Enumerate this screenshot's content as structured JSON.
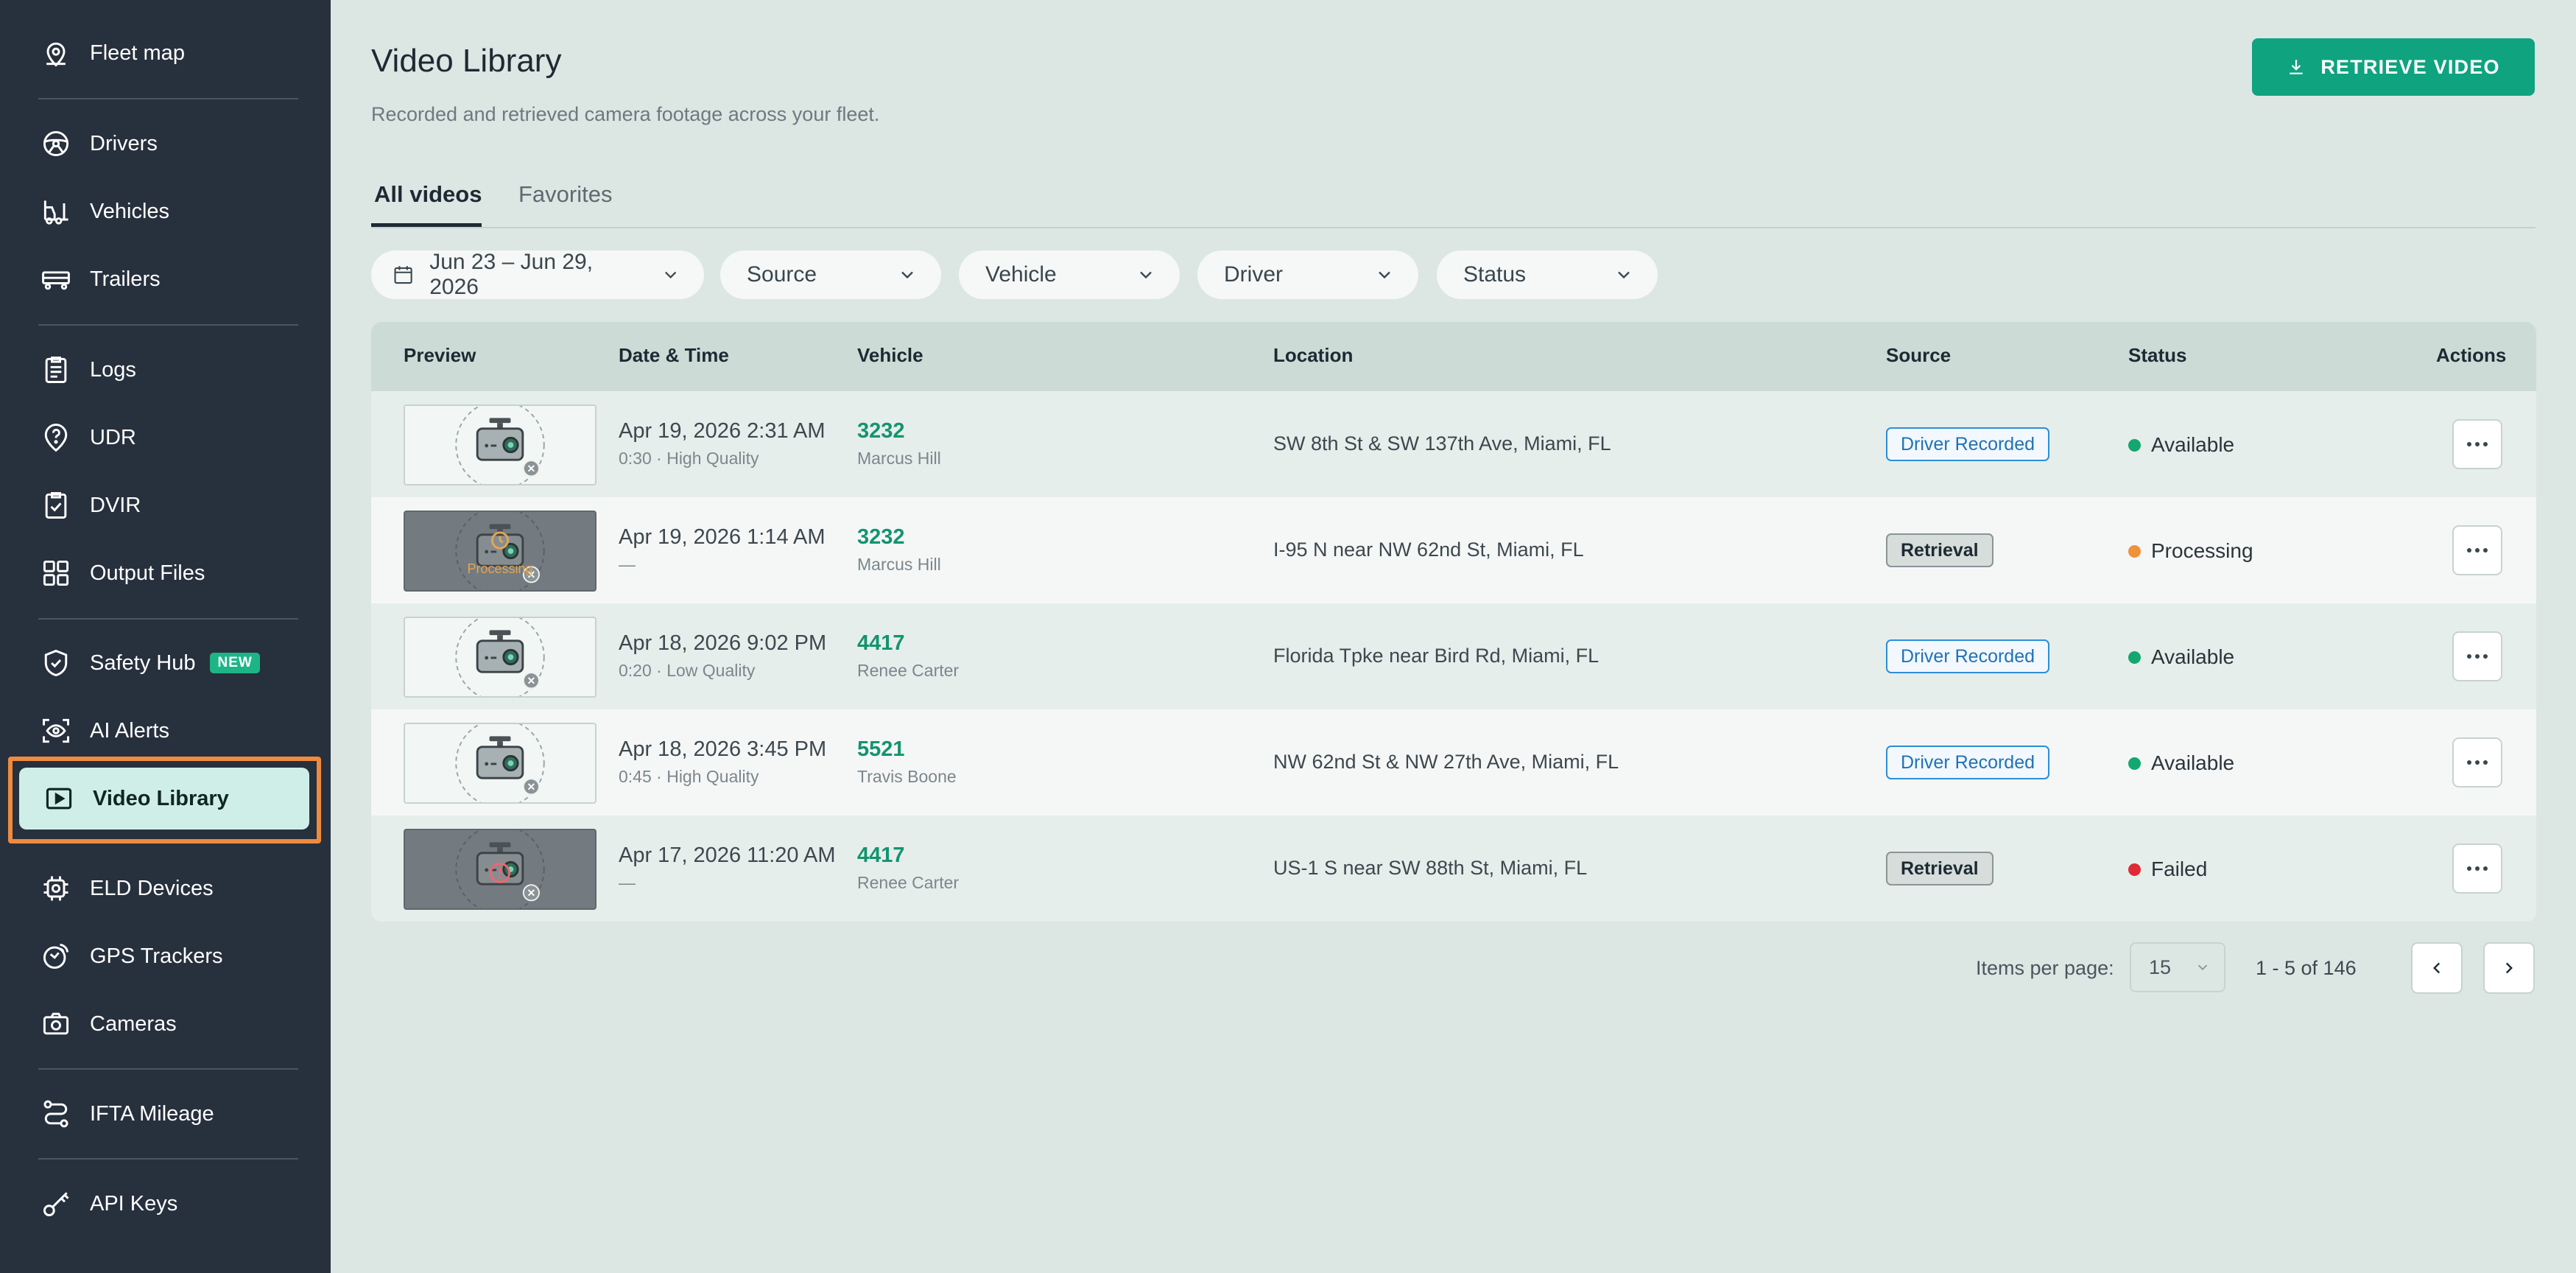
{
  "sidebar": {
    "items": [
      {
        "label": "Fleet map",
        "icon": "map-pin-icon"
      },
      {
        "label": "Drivers",
        "icon": "steering-wheel-icon"
      },
      {
        "label": "Vehicles",
        "icon": "forklift-icon"
      },
      {
        "label": "Trailers",
        "icon": "trailer-icon"
      },
      {
        "label": "Logs",
        "icon": "clipboard-icon"
      },
      {
        "label": "UDR",
        "icon": "question-pin-icon"
      },
      {
        "label": "DVIR",
        "icon": "clipboard-check-icon"
      },
      {
        "label": "Output Files",
        "icon": "grid-icon"
      },
      {
        "label": "Safety Hub",
        "icon": "shield-check-icon",
        "badge": "NEW"
      },
      {
        "label": "AI Alerts",
        "icon": "ai-eye-icon"
      },
      {
        "label": "Video Library",
        "icon": "video-play-icon",
        "active": true
      },
      {
        "label": "ELD Devices",
        "icon": "chip-icon"
      },
      {
        "label": "GPS Trackers",
        "icon": "gps-tracker-icon"
      },
      {
        "label": "Cameras",
        "icon": "camera-icon"
      },
      {
        "label": "IFTA Mileage",
        "icon": "route-icon"
      },
      {
        "label": "API Keys",
        "icon": "key-icon"
      }
    ]
  },
  "header": {
    "title": "Video Library",
    "subtitle": "Recorded and retrieved camera footage across your fleet.",
    "primary_button": "RETRIEVE VIDEO"
  },
  "tabs": [
    {
      "label": "All videos",
      "active": true
    },
    {
      "label": "Favorites",
      "active": false
    }
  ],
  "filters": {
    "date_range": "Jun 23 – Jun 29, 2026",
    "source": "Source",
    "vehicle": "Vehicle",
    "driver": "Driver",
    "status": "Status"
  },
  "table": {
    "columns": [
      "Preview",
      "Date & Time",
      "Vehicle",
      "Location",
      "Source",
      "Status",
      "Actions"
    ],
    "rows": [
      {
        "date": "Apr 19, 2026 2:31 AM",
        "meta": "0:30 · High Quality",
        "vehicle": "3232",
        "driver": "Marcus Hill",
        "location": "SW 8th St & SW 137th Ave, Miami, FL",
        "source": "Driver Recorded",
        "status": "Available",
        "thumb": "light",
        "thumb_text": ""
      },
      {
        "date": "Apr 19, 2026 1:14 AM",
        "meta": "—",
        "vehicle": "3232",
        "driver": "Marcus Hill",
        "location": "I-95 N near NW 62nd St, Miami, FL",
        "source": "Retrieval",
        "status": "Processing",
        "thumb": "processing",
        "thumb_text": "Processing"
      },
      {
        "date": "Apr 18, 2026 9:02 PM",
        "meta": "0:20 · Low Quality",
        "vehicle": "4417",
        "driver": "Renee Carter",
        "location": "Florida Tpke near Bird Rd, Miami, FL",
        "source": "Driver Recorded",
        "status": "Available",
        "thumb": "light",
        "thumb_text": ""
      },
      {
        "date": "Apr 18, 2026 3:45 PM",
        "meta": "0:45 · High Quality",
        "vehicle": "5521",
        "driver": "Travis Boone",
        "location": "NW 62nd St & NW 27th Ave, Miami, FL",
        "source": "Driver Recorded",
        "status": "Available",
        "thumb": "light",
        "thumb_text": ""
      },
      {
        "date": "Apr 17, 2026 11:20 AM",
        "meta": "—",
        "vehicle": "4417",
        "driver": "Renee Carter",
        "location": "US-1 S near SW 88th St, Miami, FL",
        "source": "Retrieval",
        "status": "Failed",
        "thumb": "failed",
        "thumb_text": ""
      }
    ]
  },
  "pagination": {
    "items_per_page_label": "Items per page:",
    "items_per_page": "15",
    "range": "1 - 5 of 146"
  },
  "colors": {
    "accent": "#0fa37f",
    "status_available": "#12a86f",
    "status_processing": "#f0923a",
    "status_failed": "#e02a35",
    "sidebar_bg": "#27303d",
    "focus_ring": "#f08a3c"
  }
}
